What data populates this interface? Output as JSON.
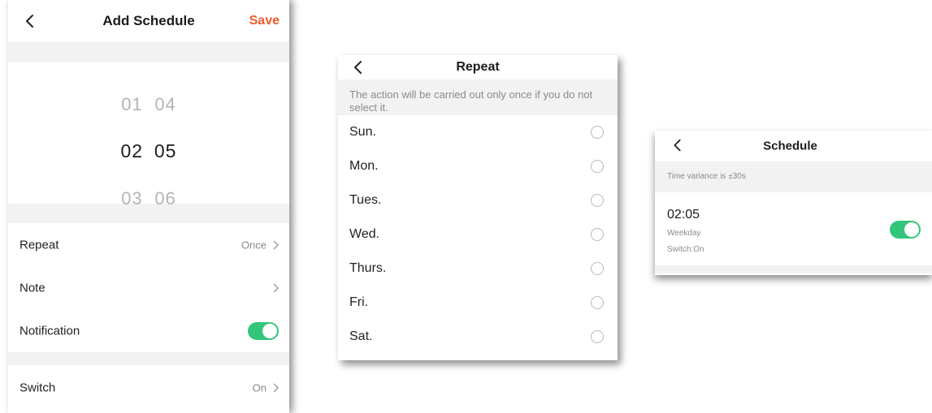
{
  "add_schedule": {
    "title": "Add Schedule",
    "save_label": "Save",
    "picker": [
      {
        "hour": "01",
        "minute": "04"
      },
      {
        "hour": "02",
        "minute": "05"
      },
      {
        "hour": "03",
        "minute": "06"
      }
    ],
    "repeat_label": "Repeat",
    "repeat_value": "Once",
    "note_label": "Note",
    "notification_label": "Notification",
    "notification_on": true,
    "switch_label": "Switch",
    "switch_value": "On"
  },
  "repeat": {
    "title": "Repeat",
    "note": "The action will be carried out only once if you do not select it.",
    "days": [
      "Sun.",
      "Mon.",
      "Tues.",
      "Wed.",
      "Thurs.",
      "Fri.",
      "Sat."
    ]
  },
  "schedule": {
    "title": "Schedule",
    "variance": "Time variance is ±30s",
    "item_time": "02:05",
    "item_repeat": "Weekday",
    "item_switch": "Switch:On",
    "item_enabled": true
  },
  "icons": {
    "back": "chevron-left-icon",
    "row_arrow": "chevron-right-icon"
  },
  "colors": {
    "accent": "#f05a28",
    "toggle_on": "#33c57a",
    "section_bg": "#f2f2f3"
  }
}
